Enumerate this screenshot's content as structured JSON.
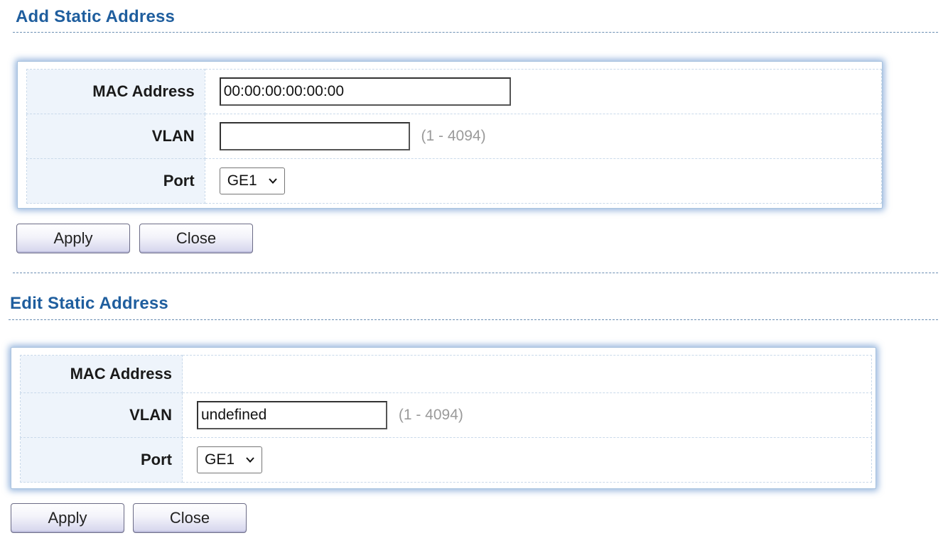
{
  "add_section": {
    "title": "Add Static Address",
    "mac_label": "MAC Address",
    "mac_value": "00:00:00:00:00:00",
    "vlan_label": "VLAN",
    "vlan_value": "",
    "vlan_hint": "(1 - 4094)",
    "port_label": "Port",
    "port_value": "GE1",
    "apply_label": "Apply",
    "close_label": "Close"
  },
  "edit_section": {
    "title": "Edit Static Address",
    "mac_label": "MAC Address",
    "mac_value": "",
    "vlan_label": "VLAN",
    "vlan_value": "undefined",
    "vlan_hint": "(1 - 4094)",
    "port_label": "Port",
    "port_value": "GE1",
    "apply_label": "Apply",
    "close_label": "Close"
  },
  "icons": {
    "dropdown": "chevron-down-icon"
  },
  "colors": {
    "title": "#1f5e9e",
    "panel_glow": "#4a80c4",
    "label_bg": "#eef4fb",
    "hint": "#9a9a9a"
  }
}
